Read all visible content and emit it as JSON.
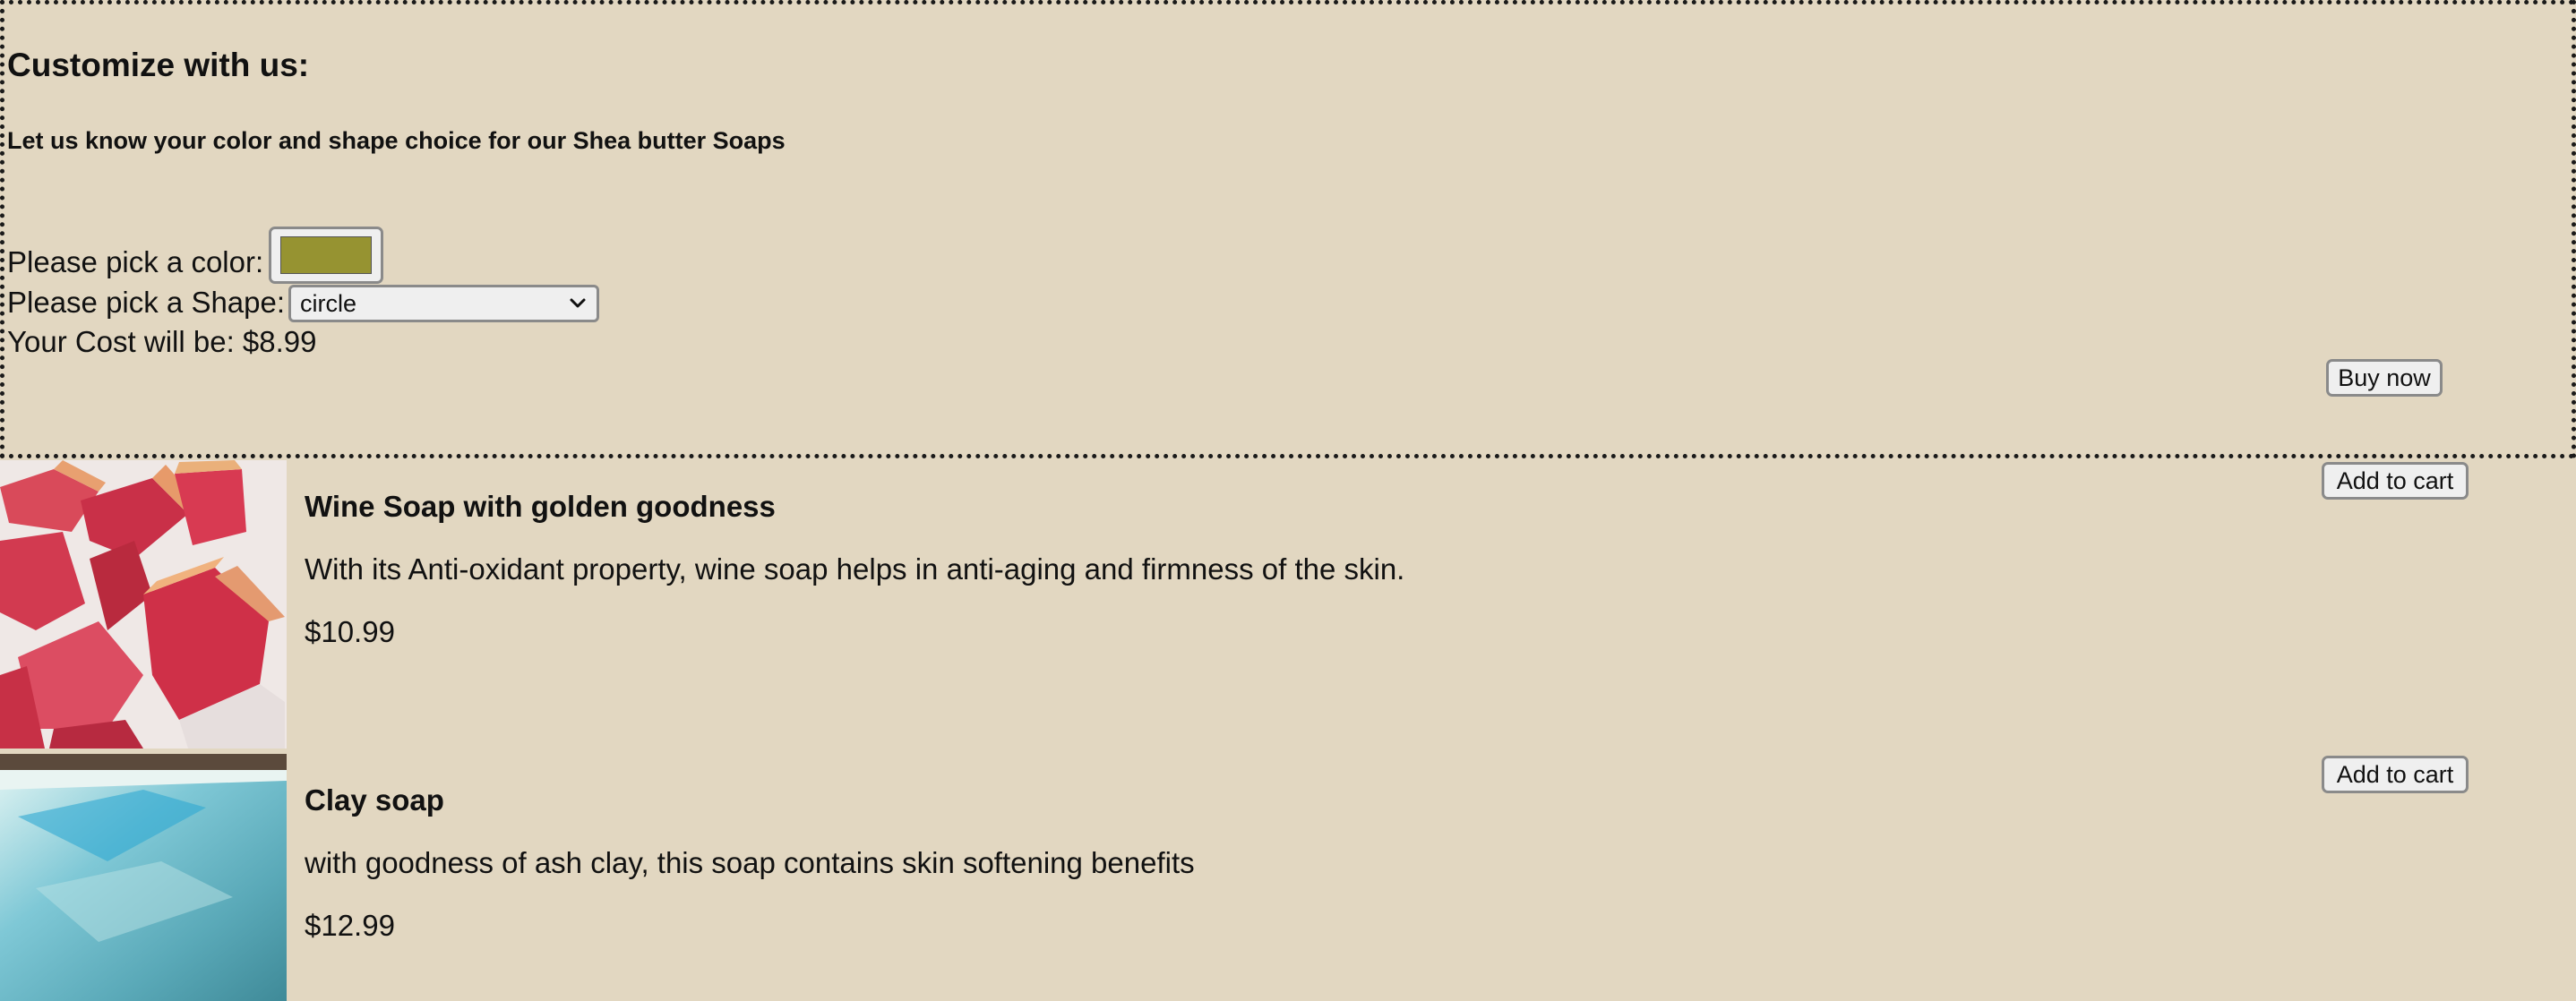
{
  "customize": {
    "title": "Customize with us:",
    "subtitle": "Let us know your color and shape choice for our Shea butter Soaps",
    "color_label": "Please pick a color:",
    "color_value": "#969331",
    "shape_label": "Please pick a Shape:",
    "shape_selected": "circle",
    "cost_label": "Your Cost will be: $8.99",
    "buy_label": "Buy now"
  },
  "products": [
    {
      "name": "Wine Soap with golden goodness",
      "description": "With its Anti-oxidant property, wine soap helps in anti-aging and firmness of the skin.",
      "price": "$10.99",
      "cart_label": "Add to cart"
    },
    {
      "name": "Clay soap",
      "description": "with goodness of ash clay, this soap contains skin softening benefits",
      "price": "$12.99",
      "cart_label": "Add to cart"
    }
  ],
  "colors": {
    "background": "#e2d7c1",
    "button_bg": "#efefef"
  }
}
